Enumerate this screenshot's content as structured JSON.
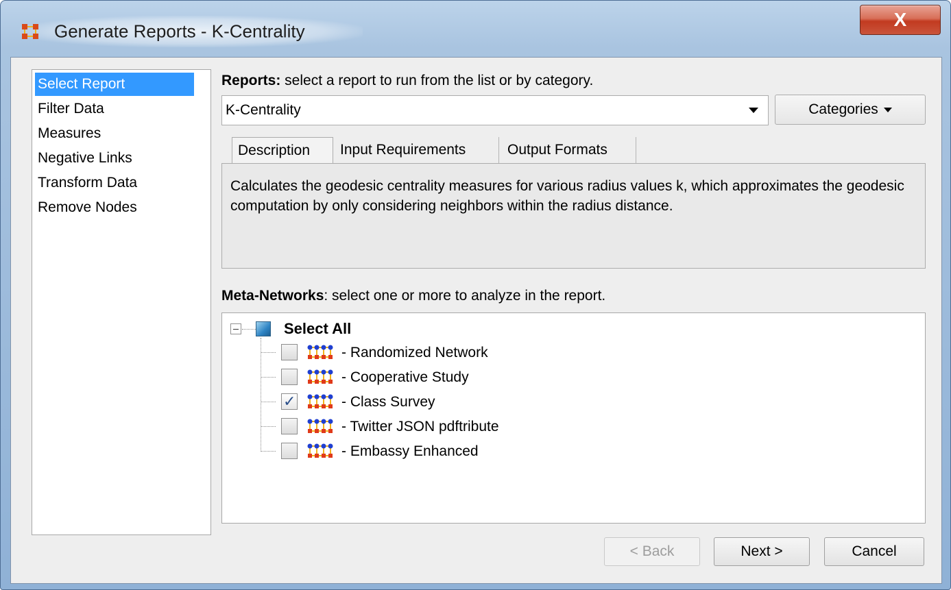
{
  "window": {
    "title": "Generate Reports - K-Centrality",
    "close_label": "X"
  },
  "nav": {
    "items": [
      {
        "label": "Select Report",
        "selected": true
      },
      {
        "label": "Filter Data",
        "selected": false
      },
      {
        "label": "Measures",
        "selected": false
      },
      {
        "label": "Negative Links",
        "selected": false
      },
      {
        "label": "Transform Data",
        "selected": false
      },
      {
        "label": "Remove Nodes",
        "selected": false
      }
    ]
  },
  "reports": {
    "label": "Reports:",
    "hint": " select a report to run from the list or by category.",
    "selected": "K-Centrality",
    "categories_label": "Categories"
  },
  "tabs": [
    {
      "label": "Description",
      "active": true
    },
    {
      "label": "Input Requirements",
      "active": false
    },
    {
      "label": "Output Formats",
      "active": false
    }
  ],
  "description": "Calculates the geodesic centrality measures for various radius values k, which approximates the geodesic computation by only considering neighbors within the radius distance.",
  "meta_networks": {
    "label": "Meta-Networks",
    "hint": ": select one or more to analyze in the report.",
    "select_all": "Select All",
    "items": [
      {
        "label": "- Randomized Network",
        "checked": false
      },
      {
        "label": "- Cooperative Study",
        "checked": false
      },
      {
        "label": "- Class Survey",
        "checked": true
      },
      {
        "label": "- Twitter JSON pdftribute",
        "checked": false
      },
      {
        "label": "- Embassy Enhanced",
        "checked": false
      }
    ]
  },
  "buttons": {
    "back": "< Back",
    "next": "Next >",
    "cancel": "Cancel"
  },
  "colors": {
    "selection": "#3399ff",
    "close": "#c9543b"
  }
}
